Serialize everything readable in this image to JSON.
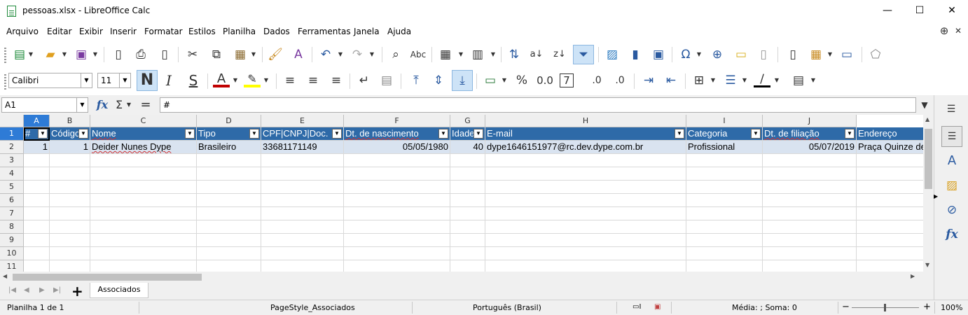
{
  "window": {
    "title": "pessoas.xlsx - LibreOffice Calc",
    "minimize": "—",
    "maximize": "☐",
    "close": "✕"
  },
  "menu": [
    "Arquivo",
    "Editar",
    "Exibir",
    "Inserir",
    "Formatar",
    "Estilos",
    "Planilha",
    "Dados",
    "Ferramentas",
    "Janela",
    "Ajuda"
  ],
  "formatting": {
    "font_name": "Calibri",
    "font_size": "11",
    "bold": "N",
    "italic": "I",
    "underline": "S"
  },
  "formula_bar": {
    "cell_ref": "A1",
    "content": "#"
  },
  "columns": [
    "A",
    "B",
    "C",
    "D",
    "E",
    "F",
    "G",
    "H",
    "I",
    "J"
  ],
  "rows": [
    "1",
    "2",
    "3",
    "4",
    "5",
    "6",
    "7",
    "8",
    "9",
    "10",
    "11"
  ],
  "table": {
    "headers": [
      "#",
      "Código",
      "Nome",
      "Tipo",
      "CPF|CNPJ|Doc.",
      "Dt. de nascimento",
      "Idade",
      "E-mail",
      "Categoria",
      "Dt. de filiação",
      "Endereço"
    ],
    "row": [
      "1",
      "1",
      "Deider Nunes Dype",
      "Brasileiro",
      "33681171149",
      "05/05/1980",
      "40",
      "dype1646151977@rc.dev.dype.com.br",
      "Profissional",
      "05/07/2019",
      "Praça Quinze de"
    ]
  },
  "sheet_tabs": [
    "Associados"
  ],
  "status": {
    "sheet": "Planilha 1 de 1",
    "page_style": "PageStyle_Associados",
    "language": "Português (Brasil)",
    "summary": "Média: ; Soma: 0",
    "zoom": "100%"
  }
}
